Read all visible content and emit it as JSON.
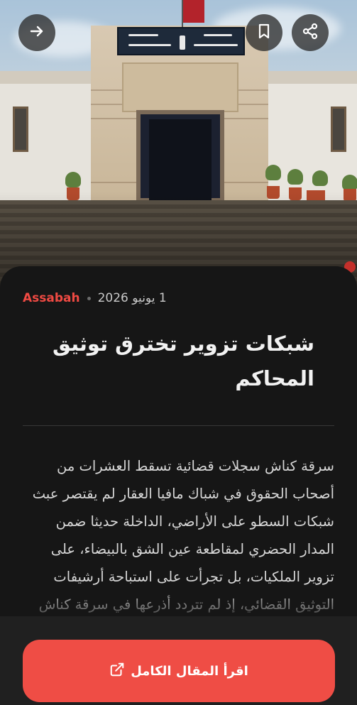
{
  "toolbar": {
    "back_icon": "arrow-right-icon",
    "bookmark_icon": "bookmark-icon",
    "share_icon": "share-icon"
  },
  "article": {
    "source": "Assabah",
    "date": "1 يونيو 2026",
    "title": "شبكات تزوير تخترق توثيق المحاكم",
    "body": "سرقة كناش سجلات قضائية تسقط العشرات من أصحاب الحقوق في شباك مافيا العقار لم يقتصر عبث شبكات السطو على الأراضي، الداخلة حديثا ضمن المدار الحضري لمقاطعة عين الشق بالبيضاء، على تزوير الملكيات، بل تجرأت على استباحة أرشيفات التوثيق القضائي، إذ لم تتردد أذرعها في سرقة كناش"
  },
  "cta": {
    "label": "اقرأ المقال الكامل",
    "icon": "external-link-icon"
  },
  "colors": {
    "accent": "#ef4d45",
    "source": "#f04a43",
    "background": "#161616"
  }
}
